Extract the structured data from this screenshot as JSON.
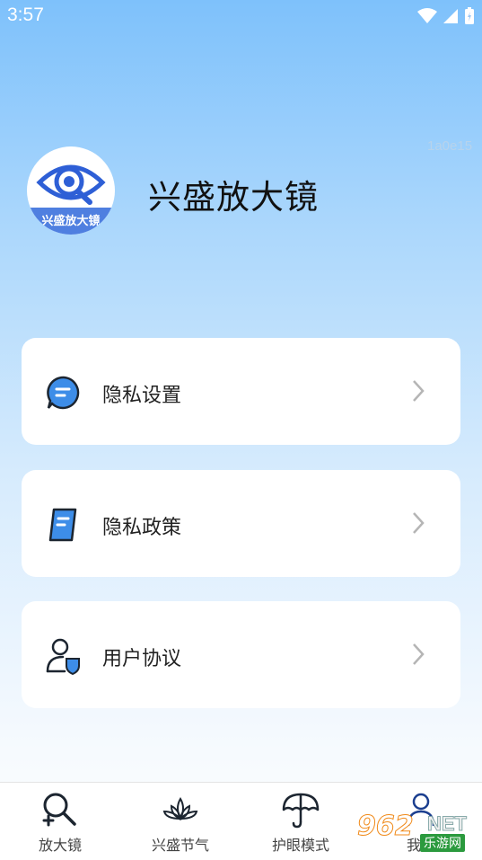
{
  "status_bar": {
    "time": "3:57"
  },
  "watermark_code": "1a0e15",
  "app": {
    "title": "兴盛放大镜",
    "logo_text": "兴盛放大镜"
  },
  "menu": [
    {
      "label": "隐私设置",
      "icon": "chat-bubble-icon"
    },
    {
      "label": "隐私政策",
      "icon": "document-icon"
    },
    {
      "label": "用户协议",
      "icon": "user-shield-icon"
    }
  ],
  "tabs": [
    {
      "label": "放大镜",
      "icon": "magnifier-plus-icon"
    },
    {
      "label": "兴盛节气",
      "icon": "lotus-icon"
    },
    {
      "label": "护眼模式",
      "icon": "umbrella-icon"
    },
    {
      "label": "我的",
      "icon": "person-icon"
    }
  ],
  "site_watermark": {
    "brand": "962",
    "tld": "NET",
    "sub": "乐游网"
  },
  "colors": {
    "accent": "#4a90e2",
    "icon_blue": "#3d8de8",
    "icon_dark": "#1c2530"
  }
}
